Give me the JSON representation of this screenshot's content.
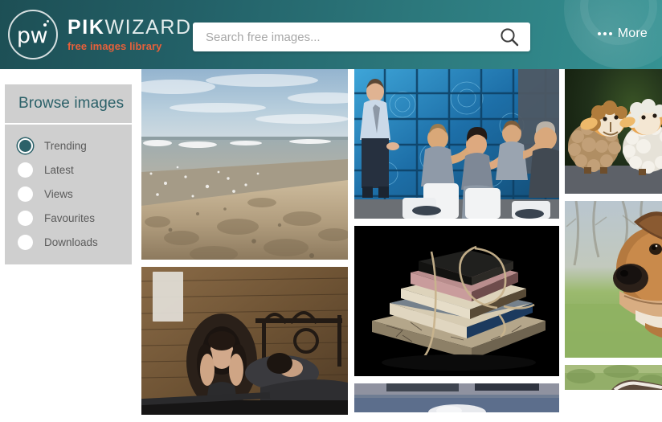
{
  "header": {
    "logo": {
      "mark_text": "pw",
      "mark_icon": "circle-monogram-logo",
      "title_strong": "PIK",
      "title_light": "WIZARD",
      "tagline": "free images library"
    },
    "search": {
      "placeholder": "Search free images...",
      "value": "",
      "icon": "search-icon"
    },
    "more": {
      "label": "More",
      "icon": "ellipsis-icon"
    },
    "colors": {
      "gradient_start": "#1d4f55",
      "gradient_end": "#359293",
      "accent_orange": "#e8603a"
    }
  },
  "sidebar": {
    "title": "Browse images",
    "selected": "Trending",
    "items": [
      {
        "label": "Trending",
        "selected": true
      },
      {
        "label": "Latest",
        "selected": false
      },
      {
        "label": "Views",
        "selected": false
      },
      {
        "label": "Favourites",
        "selected": false
      },
      {
        "label": "Downloads",
        "selected": false
      }
    ],
    "colors": {
      "panel_bg": "#cfcfcf",
      "title_color": "#2c6169",
      "label_color": "#5b5b5b"
    }
  },
  "gallery": {
    "columns": [
      {
        "items": [
          {
            "name": "beach-shoreline-photo",
            "alt": "Sandy beach with shoreline waves and blue sky"
          },
          {
            "name": "woman-insomnia-photo",
            "alt": "Woman sitting up in bed holding her head, man sleeping beside her"
          }
        ]
      },
      {
        "items": [
          {
            "name": "business-meeting-photo",
            "alt": "Presenter before seated colleagues against a wall of blue tech screens"
          },
          {
            "name": "stacked-books-photo",
            "alt": "Stack of antique books tied with twine on black background"
          },
          {
            "name": "partial-photo-bottom",
            "alt": "Partially visible photo at bottom of column"
          }
        ]
      },
      {
        "items": [
          {
            "name": "toy-sheep-photo",
            "alt": "Two toy sheep figurines, brown and white"
          },
          {
            "name": "dog-closeup-photo",
            "alt": "Close up of a dog's snout with green grass background"
          },
          {
            "name": "partial-photo-bottom-2",
            "alt": "Partially visible photo at bottom of column"
          }
        ]
      }
    ]
  }
}
